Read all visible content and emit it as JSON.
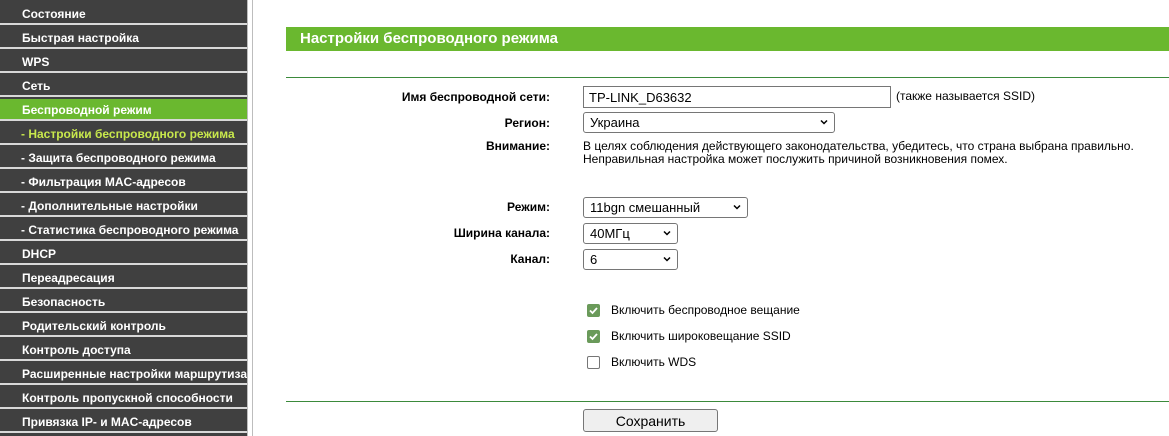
{
  "sidebar": {
    "items": [
      {
        "label": "Состояние"
      },
      {
        "label": "Быстрая настройка"
      },
      {
        "label": "WPS"
      },
      {
        "label": "Сеть"
      },
      {
        "label": "Беспроводной режим"
      },
      {
        "label": "- Настройки беспроводного режима"
      },
      {
        "label": "- Защита беспроводного режима"
      },
      {
        "label": "- Фильтрация MAC-адресов"
      },
      {
        "label": "- Дополнительные настройки"
      },
      {
        "label": "- Статистика беспроводного режима"
      },
      {
        "label": "DHCP"
      },
      {
        "label": "Переадресация"
      },
      {
        "label": "Безопасность"
      },
      {
        "label": "Родительский контроль"
      },
      {
        "label": "Контроль доступа"
      },
      {
        "label": "Расширенные настройки маршрутизатора"
      },
      {
        "label": "Контроль пропускной способности"
      },
      {
        "label": "Привязка IP- и MAC-адресов"
      }
    ]
  },
  "main": {
    "title": "Настройки беспроводного режима",
    "ssid": {
      "label": "Имя беспроводной сети:",
      "value": "TP-LINK_D63632",
      "hint": "(также называется SSID)"
    },
    "region": {
      "label": "Регион:",
      "value": "Украина"
    },
    "warning": {
      "label": "Внимание:",
      "line1": "В целях соблюдения действующего законодательства, убедитесь, что страна выбрана правильно.",
      "line2": "Неправильная настройка может послужить причиной возникновения помех."
    },
    "mode": {
      "label": "Режим:",
      "value": "11bgn смешанный"
    },
    "width": {
      "label": "Ширина канала:",
      "value": "40МГц"
    },
    "channel": {
      "label": "Канал:",
      "value": "6"
    },
    "checkboxes": [
      {
        "label": "Включить беспроводное вещание",
        "checked": true
      },
      {
        "label": "Включить широковещание SSID",
        "checked": true
      },
      {
        "label": "Включить WDS",
        "checked": false
      }
    ],
    "save_label": "Сохранить"
  },
  "colors": {
    "accent": "#6ab82f",
    "sidebar_bg": "#404040",
    "current_item": "#c8e84c"
  }
}
